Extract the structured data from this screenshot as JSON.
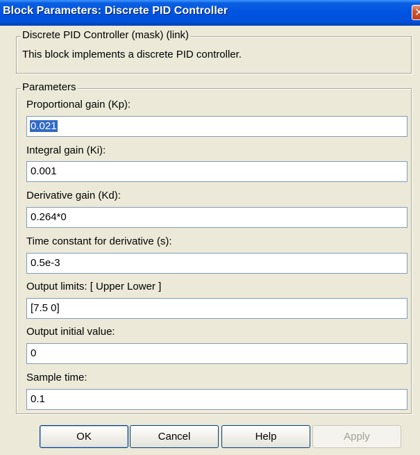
{
  "window": {
    "title": "Block Parameters: Discrete PID Controller",
    "close_glyph": "✕"
  },
  "description_group": {
    "legend": "Discrete PID Controller (mask) (link)",
    "text": "This block implements a discrete PID controller."
  },
  "parameters_group": {
    "legend": "Parameters",
    "fields": [
      {
        "label": "Proportional gain (Kp):",
        "value": "0.021"
      },
      {
        "label": "Integral gain (Ki):",
        "value": "0.001"
      },
      {
        "label": "Derivative gain (Kd):",
        "value": "0.264*0"
      },
      {
        "label": "Time constant for derivative (s):",
        "value": "0.5e-3"
      },
      {
        "label": "Output limits: [ Upper   Lower ]",
        "value": "[7.5 0]"
      },
      {
        "label": "Output initial value:",
        "value": "0"
      },
      {
        "label": "Sample time:",
        "value": "0.1"
      }
    ]
  },
  "buttons": {
    "ok": "OK",
    "cancel": "Cancel",
    "help": "Help",
    "apply": "Apply"
  },
  "colors": {
    "titlebar": "#0053e1",
    "dialog_bg": "#ece9d8",
    "selection": "#316ac5"
  }
}
